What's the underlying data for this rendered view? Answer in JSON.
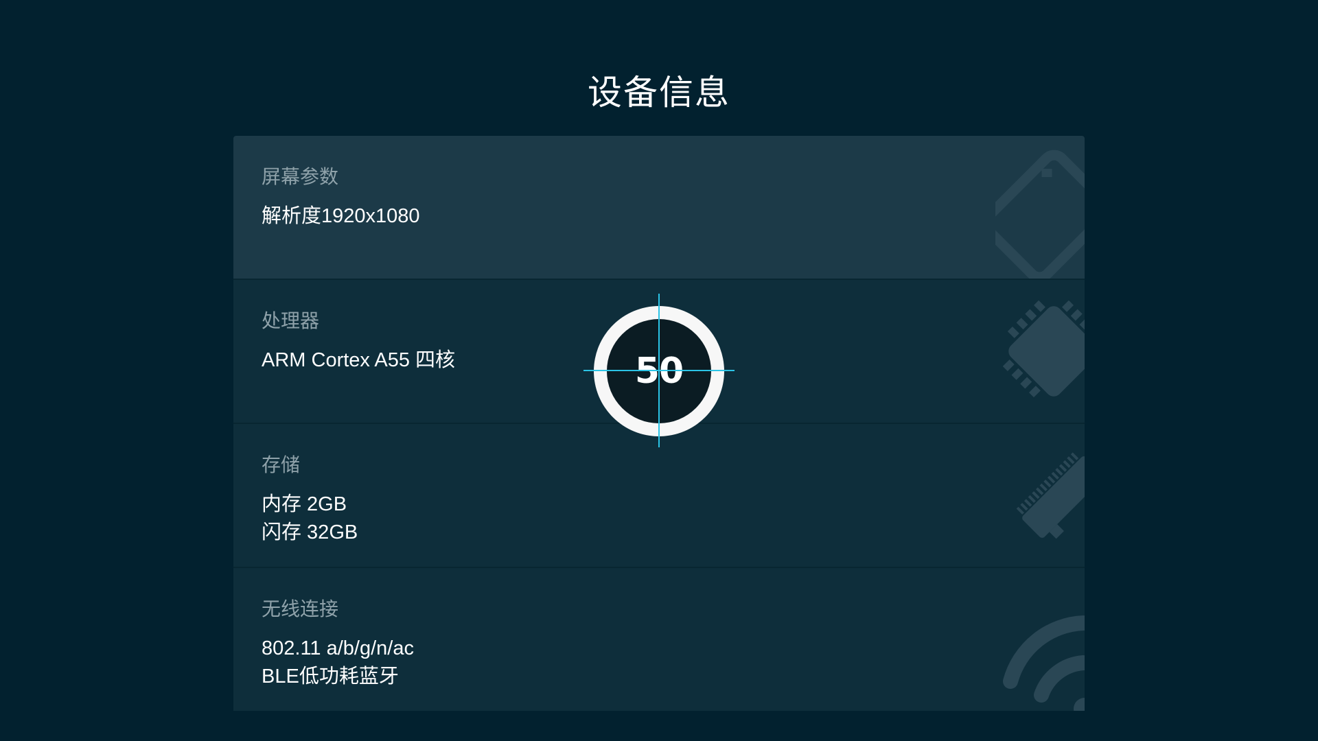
{
  "page": {
    "title": "设备信息"
  },
  "rows": [
    {
      "label": "屏幕参数",
      "values": [
        "解析度1920x1080"
      ],
      "icon": "tv-icon"
    },
    {
      "label": "处理器",
      "values": [
        "ARM Cortex A55 四核"
      ],
      "icon": "chip-icon"
    },
    {
      "label": "存储",
      "values": [
        "内存 2GB",
        "闪存 32GB"
      ],
      "icon": "memory-icon"
    },
    {
      "label": "无线连接",
      "values": [
        "802.11 a/b/g/n/ac",
        "BLE低功耗蓝牙"
      ],
      "icon": "wifi-icon"
    }
  ],
  "loader": {
    "value": "50"
  },
  "colors": {
    "background": "#02212f",
    "panel_highlight": "#1c3a48",
    "panel": "#0e2e3b",
    "label": "#8fa2aa",
    "crosshair": "#2bc4e6"
  }
}
